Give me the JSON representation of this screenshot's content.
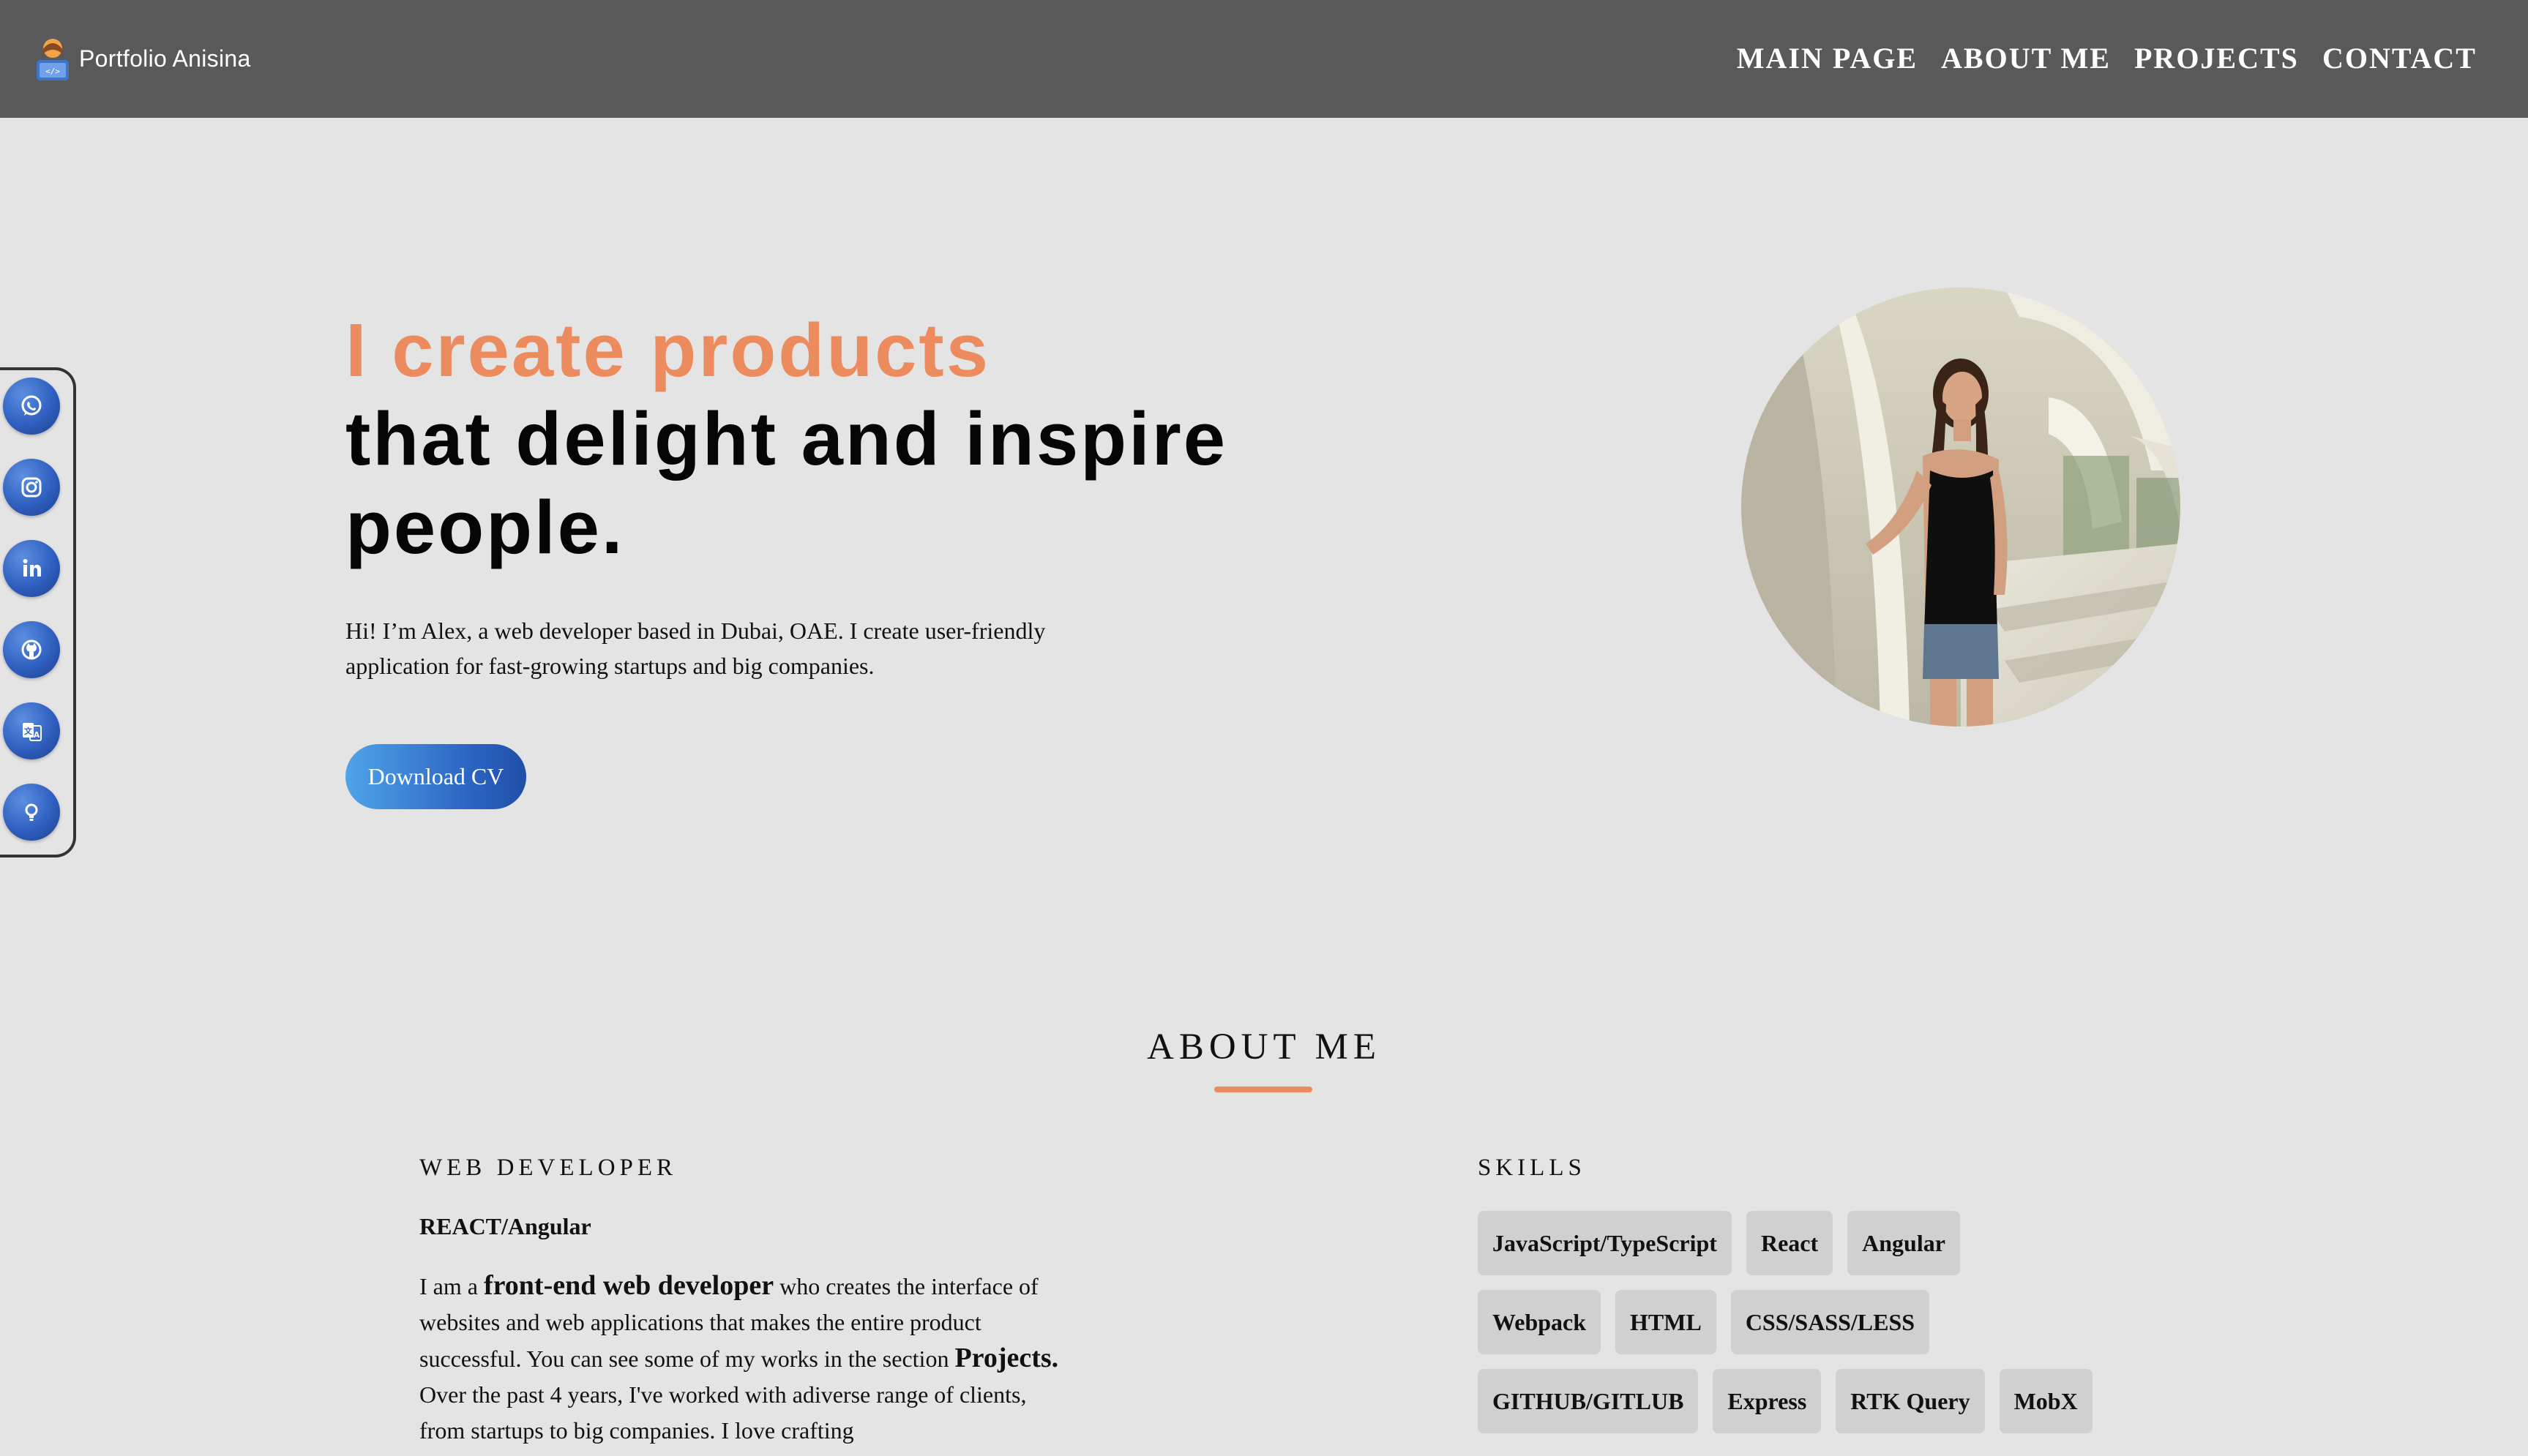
{
  "header": {
    "logo_text": "Portfolio Anisina",
    "nav": [
      "MAIN PAGE",
      "ABOUT ME",
      "PROJECTS",
      "CONTACT"
    ]
  },
  "social": [
    "whatsapp-icon",
    "instagram-icon",
    "linkedin-icon",
    "github-icon",
    "translate-icon",
    "lightbulb-icon"
  ],
  "hero": {
    "title_accent": "I create products",
    "title_line2": "that delight and inspire",
    "title_line3": "people.",
    "intro": "Hi! I’m Alex, a web developer based in Dubai, OAE. I create user-friendly application for fast-growing startups and big companies.",
    "cv_button": "Download CV"
  },
  "about": {
    "title": "ABOUT ME",
    "left_heading": "WEB DEVELOPER",
    "role": "REACT/Angular",
    "bio": {
      "p1": "I am a ",
      "b1": "front-end web developer",
      "p2": " who creates the interface of websites and web applications that makes the entire product successful. You can see some of my works in the section ",
      "b2": "Projects.",
      "p3": " Over the past 4 years, I've worked with adiverse range of clients, from startups to big companies. I love crafting"
    },
    "skills_heading": "SKILLS",
    "skills": [
      [
        "JavaScript/TypeScript",
        "React",
        "Angular"
      ],
      [
        "Webpack",
        "HTML",
        "CSS/SASS/LESS"
      ],
      [
        "GITHUB/GITLUB",
        "Express",
        "RTK Query",
        "MobX"
      ]
    ]
  },
  "colors": {
    "header_bg": "#595959",
    "page_bg": "#e4e4e4",
    "accent": "#ec8c5e",
    "button_blue": "#2b63c2",
    "chip_bg": "#d0d0d0"
  }
}
